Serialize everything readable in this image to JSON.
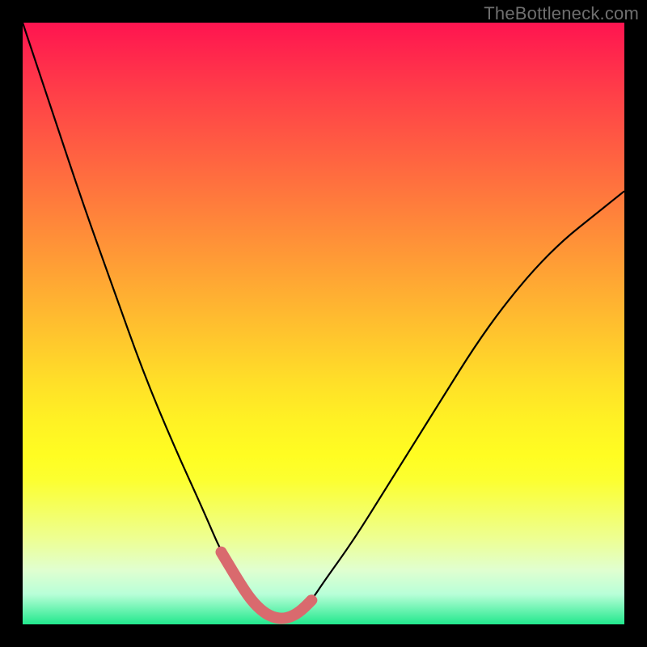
{
  "watermark": "TheBottleneck.com",
  "colors": {
    "background": "#000000",
    "gradient_top": "#ff1450",
    "gradient_bottom": "#22e88d",
    "curve": "#000000",
    "trough_highlight": "#d96a6e",
    "watermark_text": "#6f6f6f"
  },
  "chart_data": {
    "type": "line",
    "title": "",
    "xlabel": "",
    "ylabel": "",
    "xlim": [
      0,
      100
    ],
    "ylim": [
      0,
      100
    ],
    "annotations": [
      "TheBottleneck.com"
    ],
    "series": [
      {
        "name": "bottleneck-curve",
        "x": [
          0,
          5,
          10,
          15,
          20,
          25,
          30,
          33,
          36,
          38,
          40,
          42,
          44,
          46,
          48,
          50,
          55,
          60,
          65,
          70,
          75,
          80,
          85,
          90,
          95,
          100
        ],
        "values": [
          100,
          85,
          70,
          56,
          42,
          30,
          19,
          12,
          7,
          4,
          2,
          1,
          1,
          2,
          4,
          7,
          14,
          22,
          30,
          38,
          46,
          53,
          59,
          64,
          68,
          72
        ]
      }
    ],
    "trough_range_x": [
      33,
      48
    ],
    "background_heatmap": {
      "orientation": "vertical",
      "stops": [
        {
          "pos": 0.0,
          "color": "#ff1450"
        },
        {
          "pos": 0.3,
          "color": "#ff7c3c"
        },
        {
          "pos": 0.6,
          "color": "#ffe028"
        },
        {
          "pos": 0.8,
          "color": "#f6ff58"
        },
        {
          "pos": 1.0,
          "color": "#22e88d"
        }
      ]
    }
  }
}
